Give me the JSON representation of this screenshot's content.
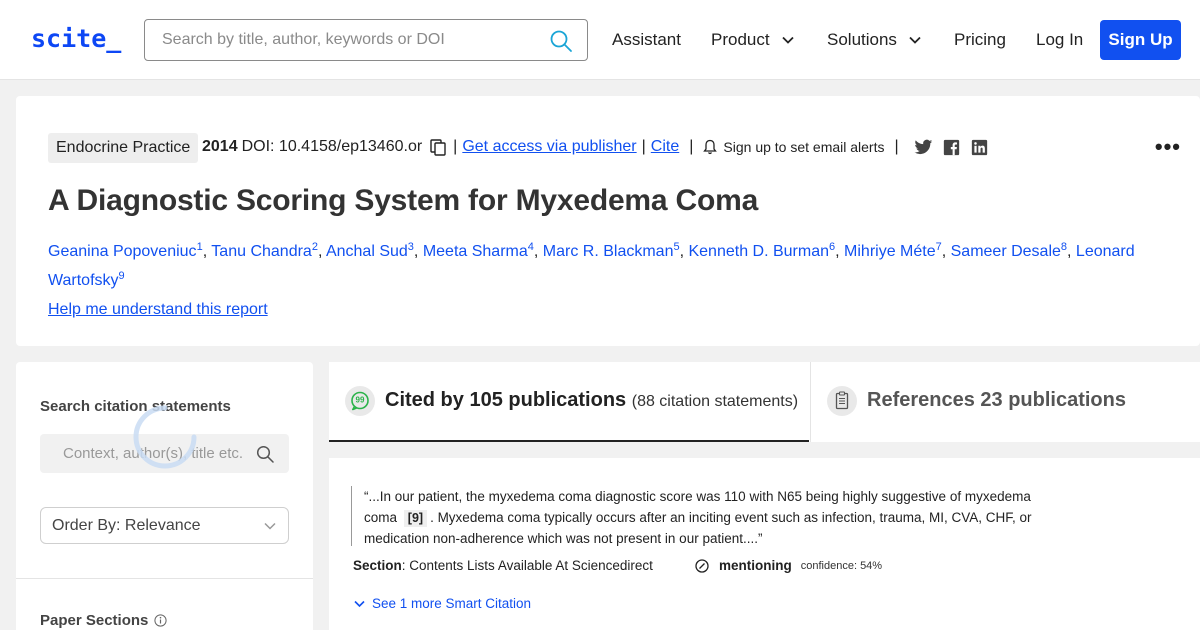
{
  "header": {
    "logo": "scite_",
    "search_placeholder": "Search by title, author, keywords or DOI",
    "nav": {
      "assistant": "Assistant",
      "product": "Product",
      "solutions": "Solutions",
      "pricing": "Pricing",
      "login": "Log In",
      "signup": "Sign Up"
    }
  },
  "paper": {
    "journal": "Endocrine Practice",
    "year": "2014",
    "doi": "DOI: 10.4158/ep13460.or",
    "access_link": "Get access via publisher",
    "cite_link": "Cite",
    "alerts": "Sign up to set email alerts",
    "more": "•••",
    "title": "A Diagnostic Scoring System for Myxedema Coma",
    "authors": [
      {
        "name": "Geanina Popoveniuc",
        "n": "1"
      },
      {
        "name": "Tanu Chandra",
        "n": "2"
      },
      {
        "name": "Anchal Sud",
        "n": "3"
      },
      {
        "name": "Meeta Sharma",
        "n": "4"
      },
      {
        "name": "Marc R. Blackman",
        "n": "5"
      },
      {
        "name": "Kenneth D. Burman",
        "n": "6"
      },
      {
        "name": "Mihriye Méte",
        "n": "7"
      },
      {
        "name": "Sameer Desale",
        "n": "8"
      },
      {
        "name": "Leonard Wartofsky",
        "n": "9"
      }
    ],
    "help_link": "Help me understand this report"
  },
  "left_panel": {
    "search_label": "Search citation statements",
    "search_placeholder": "Context, author(s), title etc.",
    "order_by": "Order By: Relevance",
    "sections_label": "Paper Sections"
  },
  "tabs": {
    "cited_main": "Cited by 105 publications",
    "cited_sub": "(88 citation statements)",
    "refs": "References 23 publications"
  },
  "citation": {
    "quote_before": "“...In our patient, the myxedema coma diagnostic score was 110 with N65 being highly suggestive of myxedema coma",
    "ref": "[9]",
    "quote_after": ". Myxedema coma typically occurs after an inciting event such as infection, trauma, MI, CVA, CHF, or medication non-adherence which was not present in our patient....”",
    "section_label": "Section",
    "section_value": ": Contents Lists Available At Sciencedirect",
    "type": "mentioning",
    "confidence": "confidence: 54%",
    "more": "See 1 more Smart Citation"
  },
  "colors": {
    "brand_blue": "#1150f0",
    "background": "#f1f1f1"
  }
}
